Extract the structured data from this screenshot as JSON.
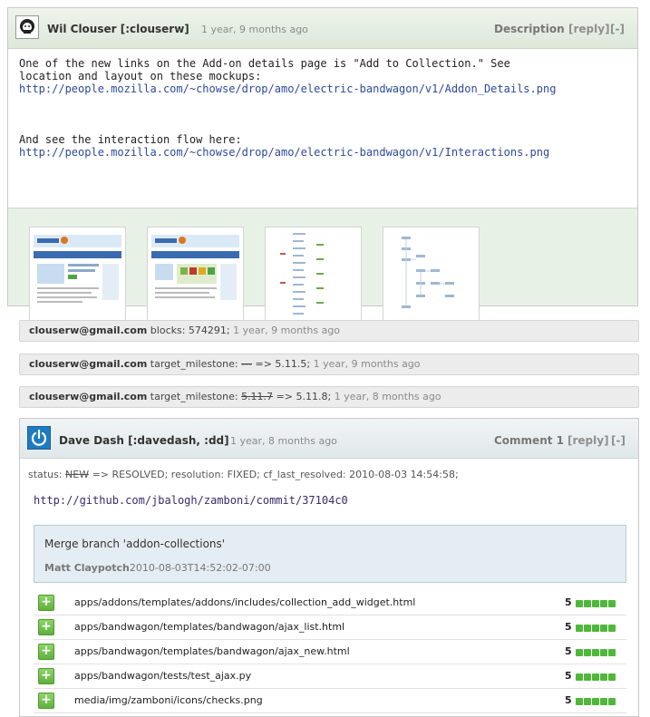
{
  "description": {
    "author": "Wil Clouser [:clouserw]",
    "time": "1 year, 9 months ago",
    "kind": "Description",
    "reply": "[reply]",
    "collapse": "[-]",
    "lines": [
      "One of the new links on the Add-on details page is \"Add to Collection.\"  See",
      "location and layout on these mockups:"
    ],
    "link1": "http://people.mozilla.com/~chowse/drop/amo/electric-bandwagon/v1/Addon_Details.png",
    "line2": "And see the interaction flow here:",
    "link2": "http://people.mozilla.com/~chowse/drop/amo/electric-bandwagon/v1/Interactions.png"
  },
  "activity": [
    {
      "who": "clouserw@gmail.com",
      "field": "blocks:",
      "old": "",
      "new": "574291;",
      "ago": "1 year, 9 months ago"
    },
    {
      "who": "clouserw@gmail.com",
      "field": "target_milestone:",
      "old": "---",
      "new": "=> 5.11.5;",
      "ago": "1 year, 9 months ago"
    },
    {
      "who": "clouserw@gmail.com",
      "field": "target_milestone:",
      "old": "5.11.7",
      "new": "=> 5.11.8;",
      "ago": "1 year, 8 months ago"
    }
  ],
  "comment": {
    "author": "Dave Dash [:davedash, :dd]",
    "time": "1 year, 8 months ago",
    "kind": "Comment 1",
    "reply": "[reply]",
    "collapse": "[-]",
    "status_prefix": "status:",
    "status_old": "NEW",
    "status_rest": "=> RESOLVED; resolution: FIXED; cf_last_resolved: 2010-08-03 14:54:58;",
    "commit_link": "http://github.com/jbalogh/zamboni/commit/37104c0",
    "merge_title": "Merge branch 'addon-collections'",
    "merge_author": "Matt Claypotch",
    "merge_date": "2010-08-03T14:52:02-07:00",
    "files": [
      {
        "name": "apps/addons/templates/addons/includes/collection_add_widget.html",
        "count": "5"
      },
      {
        "name": "apps/bandwagon/templates/bandwagon/ajax_list.html",
        "count": "5"
      },
      {
        "name": "apps/bandwagon/templates/bandwagon/ajax_new.html",
        "count": "5"
      },
      {
        "name": "apps/bandwagon/tests/test_ajax.py",
        "count": "5"
      },
      {
        "name": "media/img/zamboni/icons/checks.png",
        "count": "5"
      }
    ],
    "plus_symbol": "+"
  }
}
